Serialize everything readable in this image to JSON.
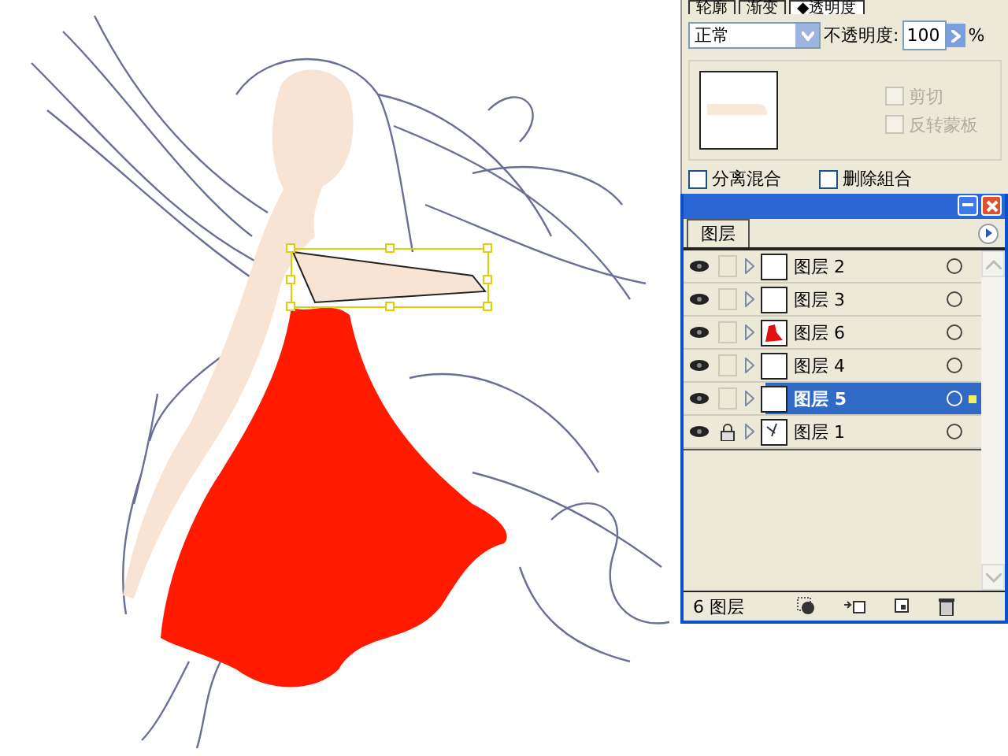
{
  "top_panel": {
    "tabs": [
      {
        "label": "轮廓",
        "selected": false
      },
      {
        "label": "渐变",
        "selected": false
      },
      {
        "label": "◆透明度",
        "selected": true
      }
    ],
    "blend_mode": "正常",
    "opacity_label": "不透明度:",
    "opacity_value": "100",
    "opacity_unit": "%",
    "mask_options": [
      {
        "label": "剪切",
        "checked": false,
        "disabled": true
      },
      {
        "label": "反转蒙板",
        "checked": false,
        "disabled": true
      }
    ],
    "options": [
      {
        "label": "分离混合",
        "checked": false
      },
      {
        "label": "删除組合",
        "checked": false
      }
    ]
  },
  "layers_panel": {
    "tab": "图层",
    "layers": [
      {
        "name": "图层 2",
        "visible": true,
        "locked": false,
        "selected": false,
        "kind": "blank"
      },
      {
        "name": "图层 3",
        "visible": true,
        "locked": false,
        "selected": false,
        "kind": "blank"
      },
      {
        "name": "图层 6",
        "visible": true,
        "locked": false,
        "selected": false,
        "kind": "red"
      },
      {
        "name": "图层 4",
        "visible": true,
        "locked": false,
        "selected": false,
        "kind": "blank"
      },
      {
        "name": "图层 5",
        "visible": true,
        "locked": false,
        "selected": true,
        "kind": "blank"
      },
      {
        "name": "图层 1",
        "visible": true,
        "locked": true,
        "selected": false,
        "kind": "sketch"
      }
    ],
    "count": "6 图层"
  }
}
